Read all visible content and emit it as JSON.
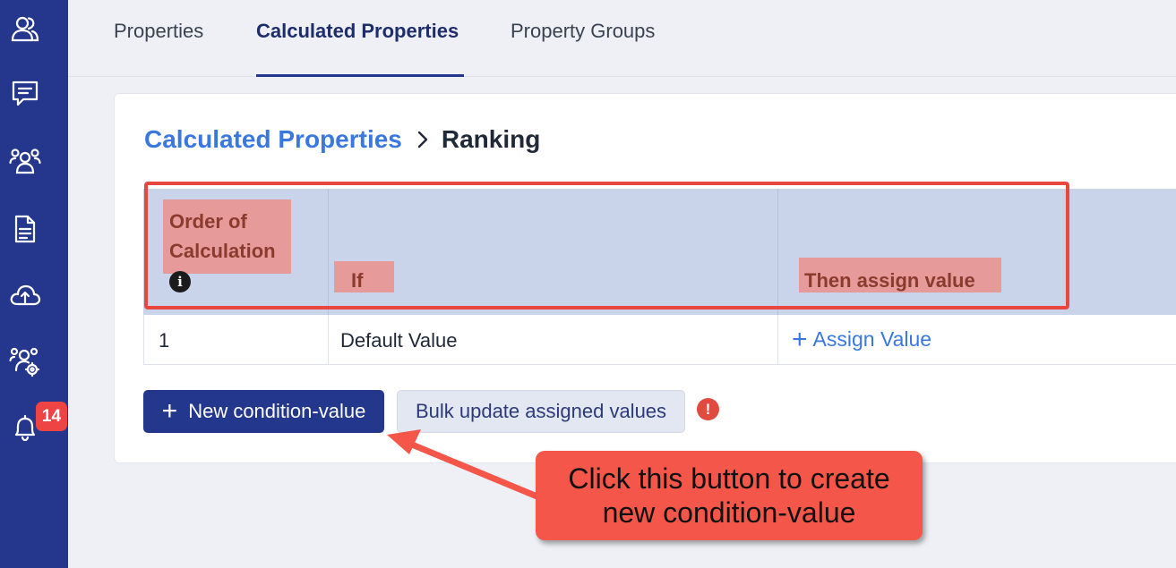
{
  "sidebar": {
    "items": [
      {
        "icon": "contacts-icon"
      },
      {
        "icon": "chat-icon"
      },
      {
        "icon": "team-icon"
      },
      {
        "icon": "document-icon"
      },
      {
        "icon": "cloud-upload-icon"
      },
      {
        "icon": "user-settings-icon"
      },
      {
        "icon": "bell-icon"
      }
    ],
    "notification_count": "14"
  },
  "tabs": [
    {
      "label": "Properties",
      "active": false
    },
    {
      "label": "Calculated Properties",
      "active": true
    },
    {
      "label": "Property Groups",
      "active": false
    }
  ],
  "breadcrumb": {
    "parent": "Calculated Properties",
    "current": "Ranking"
  },
  "table": {
    "headers": {
      "order_line1": "Order of",
      "order_line2": "Calculation",
      "if": "If",
      "then": "Then assign value"
    },
    "rows": [
      {
        "order": "1",
        "condition": "Default Value",
        "action": "Assign Value"
      }
    ]
  },
  "buttons": {
    "new_condition": "New condition-value",
    "bulk_update": "Bulk update assigned values"
  },
  "annotation": {
    "line1": "Click this button to create",
    "line2": "new condition-value"
  },
  "colors": {
    "sidebar": "#25378c",
    "accent": "#3a78e0",
    "primary_button": "#23378d",
    "annotation": "#f4564a",
    "highlight_box": "#e8473d"
  }
}
